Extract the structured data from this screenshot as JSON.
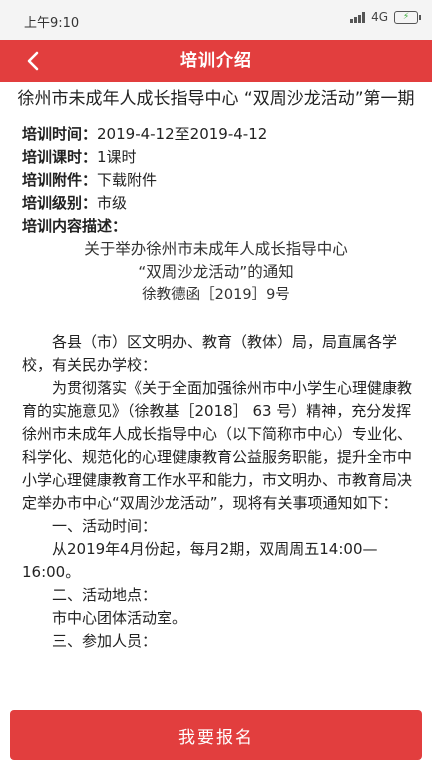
{
  "status_bar": {
    "time": "上午9:10",
    "network": "4G"
  },
  "header": {
    "title": "培训介绍"
  },
  "training": {
    "title": "徐州市未成年人成长指导中心 “双周沙龙活动”第一期",
    "fields": [
      {
        "label": "培训时间：",
        "value": "2019-4-12至2019-4-12"
      },
      {
        "label": "培训课时：",
        "value": "1课时"
      },
      {
        "label": "培训附件：",
        "value": "下载附件"
      },
      {
        "label": "培训级别：",
        "value": "市级"
      },
      {
        "label": "培训内容描述：",
        "value": ""
      }
    ]
  },
  "notice": {
    "heading_line1": "关于举办徐州市未成年人成长指导中心",
    "heading_line2": "“双周沙龙活动”的通知",
    "doc_number": "徐教德函［2019］9号",
    "recipients": "各县（市）区文明办、教育（教体）局，局直属各学校，有关民办学校：",
    "body": "为贯彻落实《关于全面加强徐州市中小学生心理健康教育的实施意见》（徐教基［2018］ 63 号）精神，充分发挥徐州市未成年人成长指导中心（以下简称市中心）专业化、科学化、规范化的心理健康教育公益服务职能，提升全市中小学心理健康教育工作水平和能力，市文明办、市教育局决定举办市中心“双周沙龙活动”，现将有关事项通知如下：",
    "item1_title": "一、活动时间：",
    "item1_text": "从2019年4月份起，每月2期，双周周五14:00—16:00。",
    "item2_title": "二、活动地点：",
    "item2_text": "市中心团体活动室。",
    "item3_title": "三、参加人员："
  },
  "footer": {
    "signup_label": "我要报名"
  },
  "colors": {
    "accent": "#e23e3e"
  }
}
